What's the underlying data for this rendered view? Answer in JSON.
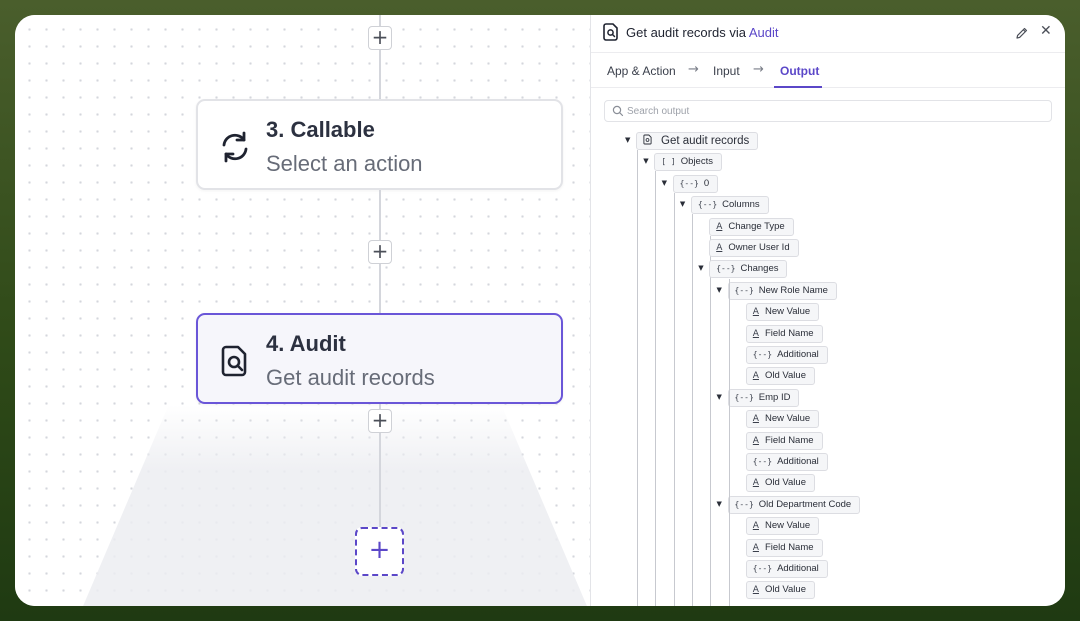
{
  "canvas": {
    "nodes": [
      {
        "icon": "refresh-icon",
        "title": "3. Callable",
        "subtitle": "Select an action"
      },
      {
        "icon": "search-document-icon",
        "title": "4. Audit",
        "subtitle": "Get audit records"
      }
    ],
    "accent_color": "#5b47c8"
  },
  "panel": {
    "title_prefix": "Get audit records via ",
    "title_app": "Audit",
    "tabs": [
      "App & Action",
      "Input",
      "Output"
    ],
    "active_tab": "Output",
    "search_placeholder": "Search output",
    "tree": {
      "root": "Get audit records",
      "objects": "Objects",
      "objects_glyph": "[ ]",
      "obj_glyph": "{--}",
      "field_glyph": "A",
      "item0": "0",
      "columns": "Columns",
      "change_type": "Change Type",
      "owner_user_id": "Owner User Id",
      "changes": "Changes",
      "groups": [
        {
          "name": "New Role Name",
          "fields": [
            "New Value",
            "Field Name",
            "Additional",
            "Old Value"
          ]
        },
        {
          "name": "Emp ID",
          "fields": [
            "New Value",
            "Field Name",
            "Additional",
            "Old Value"
          ]
        },
        {
          "name": "Old Department Code",
          "fields": [
            "New Value",
            "Field Name",
            "Additional",
            "Old Value"
          ]
        }
      ]
    }
  }
}
